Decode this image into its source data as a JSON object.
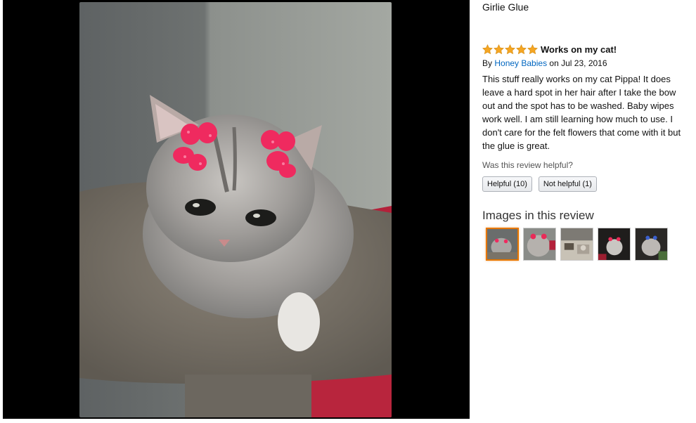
{
  "product": {
    "title": "Girlie Glue"
  },
  "review": {
    "rating": 5,
    "max_rating": 5,
    "title": "Works on my cat!",
    "by_prefix": "By",
    "author": "Honey Babies",
    "date_prefix": "on",
    "date": "Jul 23, 2016",
    "body": "This stuff really works on my cat Pippa! It does leave a hard spot in her hair after I take the bow out and the spot has to be washed. Baby wipes work well. I am still learning how much to use. I don't care for the felt flowers that come with it but the glue is great."
  },
  "helpful": {
    "question": "Was this review helpful?",
    "helpful_label": "Helpful (10)",
    "not_helpful_label": "Not helpful (1)"
  },
  "images_section": {
    "title": "Images in this review",
    "thumbnails": [
      {
        "selected": true
      },
      {
        "selected": false
      },
      {
        "selected": false
      },
      {
        "selected": false
      },
      {
        "selected": false
      }
    ]
  },
  "colors": {
    "star": "#f5a623",
    "link": "#0066c0",
    "selected_border": "#e77600",
    "viewer_bg": "#000000"
  },
  "icons": {
    "rating": "star-icon"
  }
}
